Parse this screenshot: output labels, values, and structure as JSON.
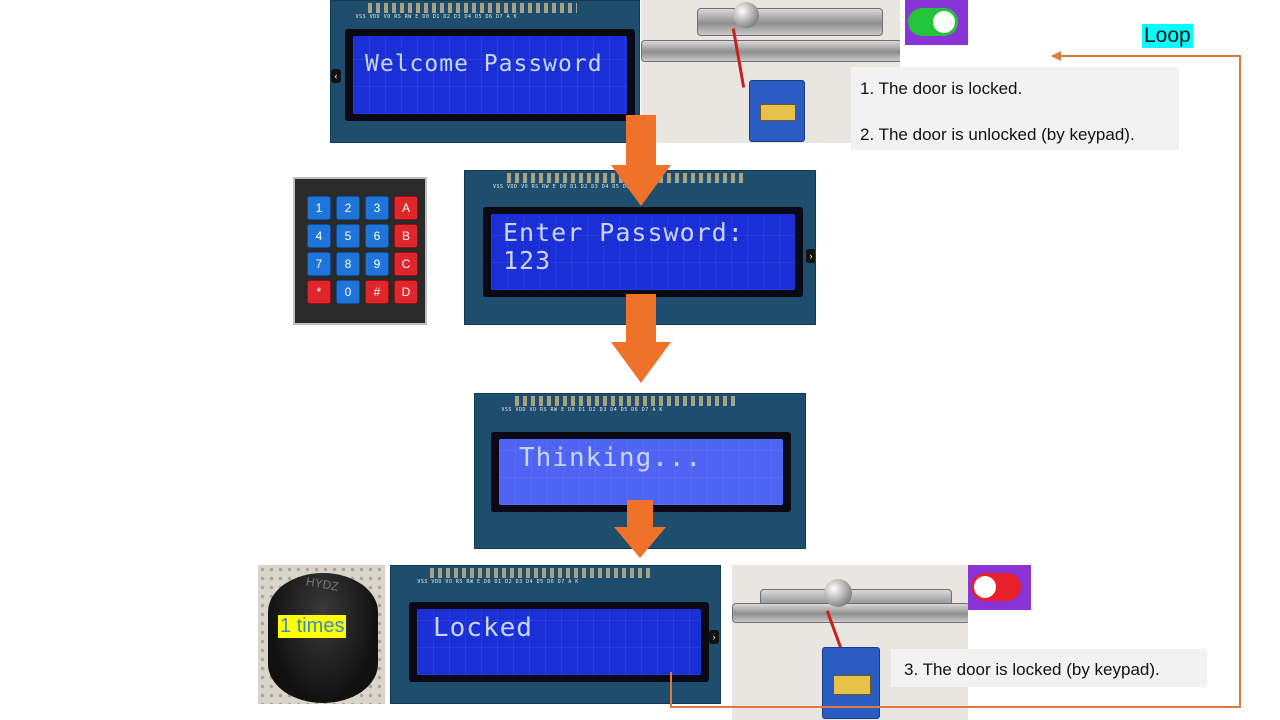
{
  "colors": {
    "arrow": "#f0712a",
    "loop_line": "#e0793f",
    "toggle_bg": "#8a33d6",
    "toggle_on": "#22c43a",
    "toggle_off": "#e8202a",
    "lcd_blue": "#1a2fd6",
    "loop_label_bg": "#00ffff",
    "buzzer_label_bg": "#ffff00"
  },
  "lcd": {
    "pin_labels": "VSS VDD VO RS RW E D0 D1 D2 D3 D4 D5 D6 D7 A K",
    "pin_number_1": "1",
    "pin_number_16": "16",
    "welcome": "Welcome Password",
    "enter_line1": "Enter Password:",
    "enter_line2": "123",
    "thinking": "Thinking...",
    "locked": "Locked",
    "scroll_glyph": "›",
    "scroll_glyph_left": "‹"
  },
  "keypad": {
    "keys": [
      "1",
      "2",
      "3",
      "A",
      "4",
      "5",
      "6",
      "B",
      "7",
      "8",
      "9",
      "C",
      "*",
      "0",
      "#",
      "D"
    ]
  },
  "notes": {
    "step1": "1. The door is locked.",
    "step2": "2. The door is unlocked (by keypad).",
    "step3": "3. The door is locked (by keypad)."
  },
  "loop_label": "Loop",
  "buzzer": {
    "label": "1 times",
    "brand": "HYDZ"
  },
  "toggles": {
    "top": "on",
    "bottom": "off"
  },
  "icons": {
    "toggle_on": "toggle-on-icon",
    "toggle_off": "toggle-off-icon",
    "flow_arrow": "down-arrow-icon"
  }
}
